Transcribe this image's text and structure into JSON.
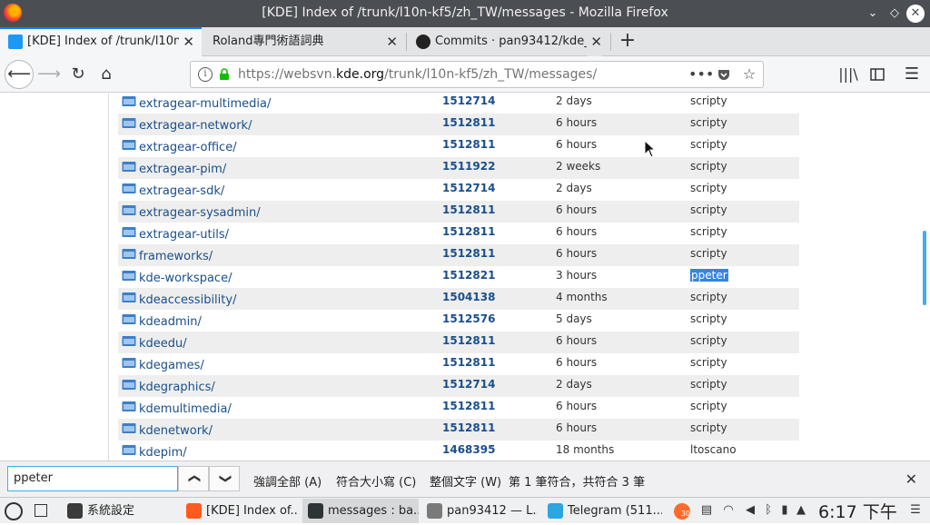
{
  "window": {
    "title": "[KDE] Index of /trunk/l10n-kf5/zh_TW/messages - Mozilla Firefox"
  },
  "tabs": [
    {
      "label": "[KDE] Index of /trunk/l10n",
      "active": true
    },
    {
      "label": "Roland專門術語詞典",
      "active": false
    },
    {
      "label": "Commits · pan93412/kde_",
      "active": false
    }
  ],
  "tab_close_glyph": "✕",
  "newtab_glyph": "+",
  "address": {
    "prefix": "https://websvn.",
    "domain": "kde.org",
    "path": "/trunk/l10n-kf5/zh_TW/messages/"
  },
  "listing": [
    {
      "name": "extragear-multimedia/",
      "rev": "1512714",
      "age": "2 days",
      "author": "scripty"
    },
    {
      "name": "extragear-network/",
      "rev": "1512811",
      "age": "6 hours",
      "author": "scripty"
    },
    {
      "name": "extragear-office/",
      "rev": "1512811",
      "age": "6 hours",
      "author": "scripty"
    },
    {
      "name": "extragear-pim/",
      "rev": "1511922",
      "age": "2 weeks",
      "author": "scripty"
    },
    {
      "name": "extragear-sdk/",
      "rev": "1512714",
      "age": "2 days",
      "author": "scripty"
    },
    {
      "name": "extragear-sysadmin/",
      "rev": "1512811",
      "age": "6 hours",
      "author": "scripty"
    },
    {
      "name": "extragear-utils/",
      "rev": "1512811",
      "age": "6 hours",
      "author": "scripty"
    },
    {
      "name": "frameworks/",
      "rev": "1512811",
      "age": "6 hours",
      "author": "scripty"
    },
    {
      "name": "kde-workspace/",
      "rev": "1512821",
      "age": "3 hours",
      "author": "ppeter",
      "highlight": true
    },
    {
      "name": "kdeaccessibility/",
      "rev": "1504138",
      "age": "4 months",
      "author": "scripty"
    },
    {
      "name": "kdeadmin/",
      "rev": "1512576",
      "age": "5 days",
      "author": "scripty"
    },
    {
      "name": "kdeedu/",
      "rev": "1512811",
      "age": "6 hours",
      "author": "scripty"
    },
    {
      "name": "kdegames/",
      "rev": "1512811",
      "age": "6 hours",
      "author": "scripty"
    },
    {
      "name": "kdegraphics/",
      "rev": "1512714",
      "age": "2 days",
      "author": "scripty"
    },
    {
      "name": "kdemultimedia/",
      "rev": "1512811",
      "age": "6 hours",
      "author": "scripty"
    },
    {
      "name": "kdenetwork/",
      "rev": "1512811",
      "age": "6 hours",
      "author": "scripty"
    },
    {
      "name": "kdepim/",
      "rev": "1468395",
      "age": "18 months",
      "author": "ltoscano"
    }
  ],
  "findbar": {
    "query": "ppeter",
    "prev_glyph": "❮",
    "next_glyph": "❯",
    "highlight_all": "強調全部 (A)",
    "match_case": "符合大小寫 (C)",
    "whole_words": "整個文字 (W)",
    "status": "第 1 筆符合，共符合 3 筆",
    "close_glyph": "✕"
  },
  "taskbar": {
    "items": [
      {
        "label": "系統設定",
        "color": "#3b3b3b",
        "active": false
      },
      {
        "label": "[KDE] Index of...",
        "color": "#ff5a1f",
        "active": false
      },
      {
        "label": "messages : ba...",
        "color": "#2e3436",
        "active": true
      },
      {
        "label": "pan93412 — L...",
        "color": "#7a7a7a",
        "active": false
      },
      {
        "label": "Telegram (511...",
        "color": "#2ca5e0",
        "active": false
      }
    ],
    "badge_count": "30",
    "clock": "6:17 下午"
  },
  "colors": {
    "accent": "#0a84ff",
    "link": "#1a4f8a",
    "selection": "#3584e4",
    "kde_blue": "#3daee9"
  },
  "icons": {
    "window_min": "chevron-down-icon",
    "window_max": "diamond-icon",
    "back": "arrow-left-icon",
    "forward": "arrow-right-icon",
    "reload": "reload-icon",
    "home": "home-icon",
    "page_actions": "ellipsis-icon",
    "pocket": "pocket-icon",
    "bookmark": "star-icon",
    "library": "library-icon",
    "sidebar": "sidebar-icon",
    "menu": "hamburger-menu-icon"
  }
}
